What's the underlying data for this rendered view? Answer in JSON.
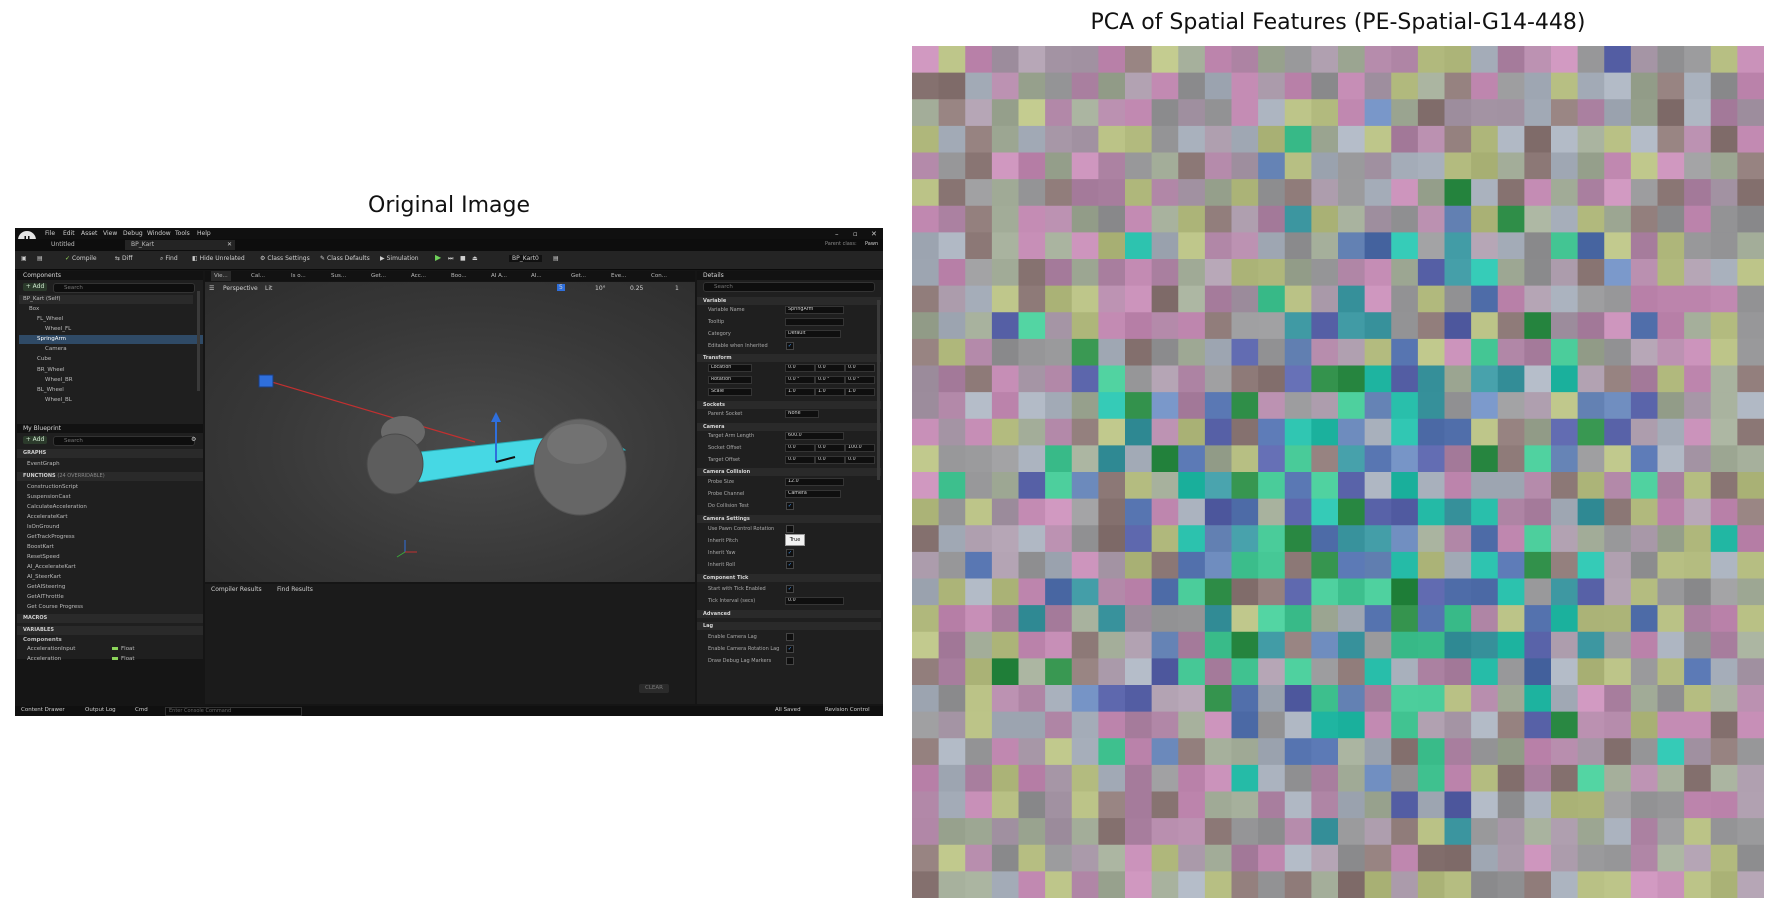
{
  "titles": {
    "left": "Original Image",
    "right": "PCA of Spatial Features (PE-Spatial-G14-448)"
  },
  "editor": {
    "menu": [
      "File",
      "Edit",
      "Asset",
      "View",
      "Debug",
      "Window",
      "Tools",
      "Help"
    ],
    "doc_tabs": [
      "Untitled",
      "BP_Kart"
    ],
    "parent_class_label": "Parent class:",
    "parent_class_value": "Pawn",
    "toolbar": {
      "compile": "Compile",
      "diff": "Diff",
      "find": "Find",
      "hide_unrelated": "Hide Unrelated",
      "class_settings": "Class Settings",
      "class_defaults": "Class Defaults",
      "simulation": "Simulation",
      "debug_object": "BP_Kart0"
    },
    "components": {
      "title": "Components",
      "add": "+ Add",
      "search_placeholder": "Search",
      "items": [
        "BP_Kart (Self)",
        "Box",
        "FL_Wheel",
        "Wheel_FL",
        "SpringArm",
        "Camera",
        "Cube",
        "BR_Wheel",
        "Wheel_BR",
        "BL_Wheel",
        "Wheel_BL"
      ]
    },
    "my_blueprint": {
      "title": "My Blueprint",
      "add": "+ Add",
      "search_placeholder": "Search",
      "graphs_label": "GRAPHS",
      "event_graph": "EventGraph",
      "functions_label": "FUNCTIONS",
      "functions_count": "(24 OVERRIDABLE)",
      "functions": [
        "ConstructionScript",
        "SuspensionCast",
        "CalculateAcceleration",
        "AccelerateKart",
        "IsOnGround",
        "GetTrackProgress",
        "BoostKart",
        "ResetSpeed",
        "AI_AccelerateKart",
        "AI_SteerKart",
        "GetAISteering",
        "GetAIThrottle",
        "Get Course Progress"
      ],
      "macros_label": "MACROS",
      "variables_label": "VARIABLES",
      "components_label": "Components",
      "variables": [
        {
          "name": "AccelerationInput",
          "type": "Float"
        },
        {
          "name": "Acceleration",
          "type": "Float"
        }
      ]
    },
    "viewport_tabs": [
      "Vie...",
      "Cal...",
      "Is o...",
      "Sus...",
      "Get...",
      "Acc...",
      "Boo...",
      "AI A...",
      "AI...",
      "Get...",
      "Eve...",
      "Con..."
    ],
    "viewport": {
      "mode": "Perspective",
      "lit": "Lit",
      "snap_grid": "5",
      "snap_rot": "10°",
      "snap_scale": "0.25",
      "camera_speed": "1"
    },
    "results_tabs": [
      "Compiler Results",
      "Find Results"
    ],
    "clear": "CLEAR",
    "details": {
      "title": "Details",
      "search_placeholder": "Search",
      "sections": {
        "variable": "Variable",
        "transform": "Transform",
        "sockets": "Sockets",
        "camera": "Camera",
        "camera_collision": "Camera Collision",
        "camera_settings": "Camera Settings",
        "component_tick": "Component Tick",
        "advanced": "Advanced",
        "lag": "Lag"
      },
      "variable_name_label": "Variable Name",
      "variable_name": "SpringArm",
      "tooltip_label": "Tooltip",
      "category_label": "Category",
      "category": "Default",
      "editable_label": "Editable when Inherited",
      "location_label": "Location",
      "rotation_label": "Rotation",
      "scale_label": "Scale",
      "location": [
        "0.0",
        "0.0",
        "0.0"
      ],
      "rotation": [
        "0.0 °",
        "0.0 °",
        "0.0 °"
      ],
      "scale": [
        "1.0",
        "1.0",
        "1.0"
      ],
      "parent_socket_label": "Parent Socket",
      "parent_socket": "None",
      "target_arm_length_label": "Target Arm Length",
      "target_arm_length": "600.0",
      "socket_offset_label": "Socket Offset",
      "socket_offset": [
        "0.0",
        "0.0",
        "100.0"
      ],
      "target_offset_label": "Target Offset",
      "target_offset": [
        "0.0",
        "0.0",
        "0.0"
      ],
      "probe_size_label": "Probe Size",
      "probe_size": "12.0",
      "probe_channel_label": "Probe Channel",
      "probe_channel": "Camera",
      "do_collision_label": "Do Collision Test",
      "tooltip_popup": "True",
      "use_pawn_label": "Use Pawn Control Rotation",
      "inherit_pitch_label": "Inherit Pitch",
      "inherit_yaw_label": "Inherit Yaw",
      "inherit_roll_label": "Inherit Roll",
      "start_tick_label": "Start with Tick Enabled",
      "tick_interval_label": "Tick Interval (secs)",
      "tick_interval": "0.0",
      "enable_cam_lag_label": "Enable Camera Lag",
      "enable_cam_rot_lag_label": "Enable Camera Rotation Lag",
      "draw_debug_label": "Draw Debug Lag Markers"
    },
    "statusbar": {
      "content_drawer": "Content Drawer",
      "output_log": "Output Log",
      "cmd": "Cmd",
      "console_placeholder": "Enter Console Command",
      "all_saved": "All Saved",
      "revision_control": "Revision Control"
    }
  },
  "colors": {
    "editor_bg": "#151515",
    "selection": "#2f4a66",
    "cyan_mesh": "#3fd6e0",
    "gizmo_blue": "#2f6fdc"
  }
}
